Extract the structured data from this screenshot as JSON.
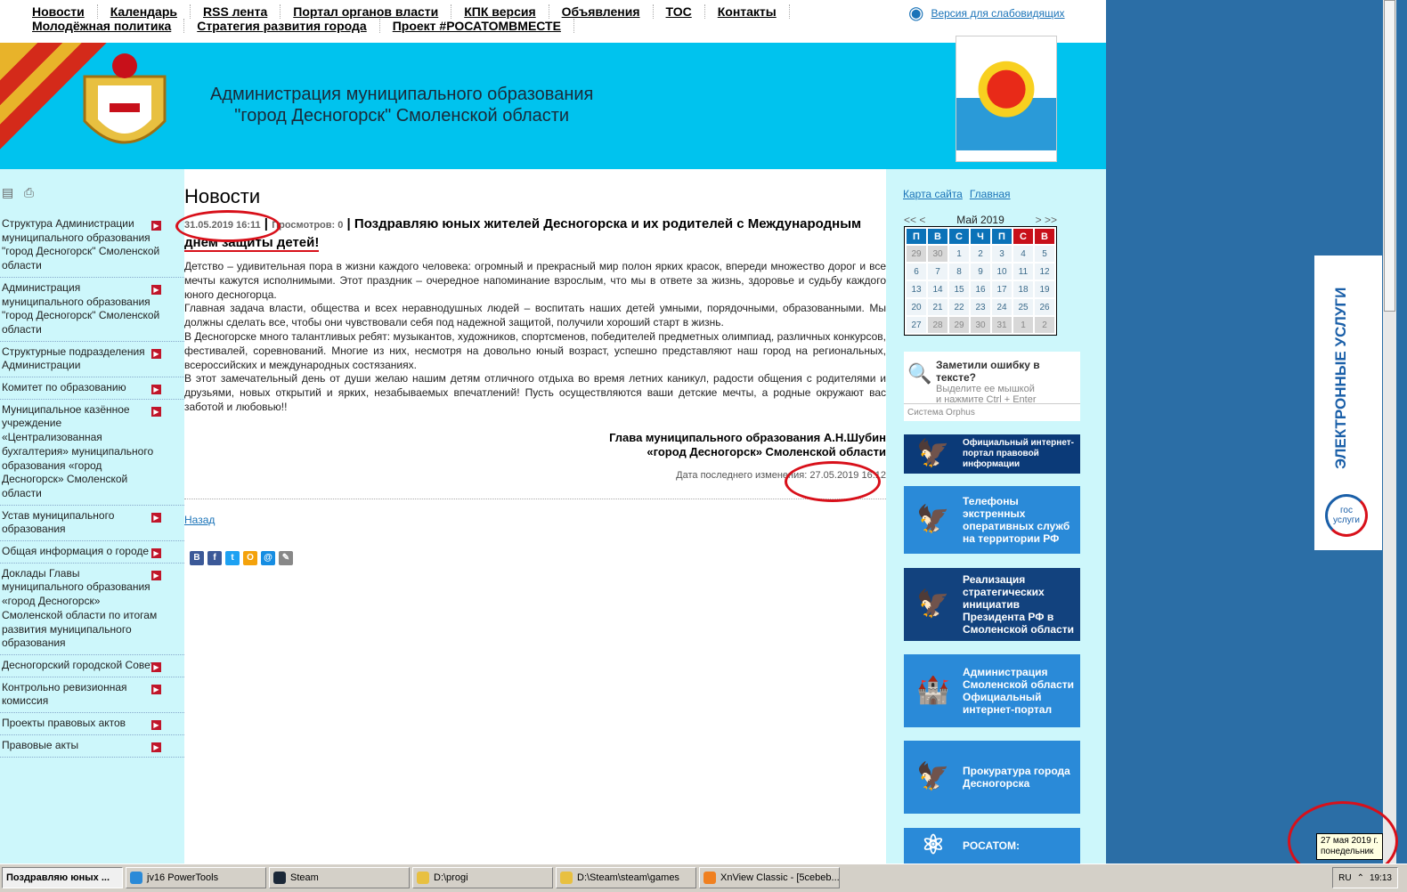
{
  "topnav": {
    "items": [
      "Новости",
      "Календарь",
      "RSS лента",
      "Портал органов власти",
      "КПК версия",
      "Объявления",
      "ТОС",
      "Контакты",
      "Молодёжная политика",
      "Стратегия развития города",
      "Проект #РОСАТОМВМЕСТЕ"
    ],
    "low_vision": "Версия для слабовидящих"
  },
  "header": {
    "title_line1": "Администрация муниципального образования",
    "title_line2": "\"город Десногорск\" Смоленской области"
  },
  "left_menu": [
    "Структура Администрации муниципального образования \"город Десногорск\" Смоленской области",
    "Администрация муниципального образования \"город Десногорск\" Смоленской области",
    "Структурные подразделения Администрации",
    "Комитет по образованию",
    "Муниципальное казённое учреждение «Централизованная бухгалтерия» муниципального образования «город Десногорск» Смоленской области",
    "Устав муниципального образования",
    "Общая информация о городе",
    "Доклады Главы муниципального образования «город Десногорск» Смоленской области по итогам развития муниципального образования",
    "Десногорский городской Совет",
    "Контрольно ревизионная комиссия",
    "Проекты правовых актов",
    "Правовые акты"
  ],
  "main": {
    "heading": "Новости",
    "date": "31.05.2019 16:11",
    "views": "Просмотров: 0",
    "title_a": "Поздравляю юных жителей Десногорска и их родителей с Международным ",
    "title_b": "днем защиты детей!",
    "paragraphs": [
      "Детство – удивительная пора в жизни каждого человека: огромный и прекрасный мир полон ярких красок, впереди множество дорог и все мечты кажутся исполнимыми. Этот праздник – очередное напоминание взрослым, что мы в ответе за жизнь, здоровье и судьбу каждого юного  десногорца.",
      "Главная задача власти, общества и всех неравнодушных людей – воспитать наших детей умными, порядочными, образованными. Мы должны сделать все, чтобы они чувствовали себя под надежной защитой, получили хороший старт в жизнь.",
      "В Десногорске много талантливых ребят: музыкантов, художников, спортсменов, победителей предметных олимпиад, различных конкурсов, фестивалей, соревнований. Многие из них, несмотря на довольно юный возраст, успешно представляют наш город на региональных, всероссийских и международных состязаниях.",
      "В этот замечательный день от души желаю нашим детям отличного отдыха во время летних каникул, радости общения с родителями и друзьями, новых открытий и ярких, незабываемых впечатлений! Пусть осуществляются ваши детские мечты, а родные окружают вас заботой и любовью!!"
    ],
    "sign1": "Глава муниципального образования А.Н.Шубин",
    "sign2": "«город Десногорск» Смоленской области",
    "modified_label": "Дата последнего изменения:",
    "modified": "27.05.2019 16:12",
    "back": "Назад",
    "share": [
      "В",
      "f",
      "t",
      "O",
      "@",
      "✎"
    ]
  },
  "right": {
    "sitemap": "Карта сайта",
    "home": "Главная",
    "cal": {
      "prev": "<< <",
      "next": "> >>",
      "month": "Май 2019",
      "days": [
        "П",
        "В",
        "С",
        "Ч",
        "П",
        "С",
        "В"
      ],
      "weeks": [
        [
          29,
          30,
          1,
          2,
          3,
          4,
          5
        ],
        [
          6,
          7,
          8,
          9,
          10,
          11,
          12
        ],
        [
          13,
          14,
          15,
          16,
          17,
          18,
          19
        ],
        [
          20,
          21,
          22,
          23,
          24,
          25,
          26
        ],
        [
          27,
          28,
          29,
          30,
          31,
          1,
          2
        ]
      ]
    },
    "orphus": {
      "title": "Заметили ошибку в тексте?",
      "l1": "Выделите ее мышкой",
      "l2": "и нажмите Ctrl + Enter",
      "sys": "Система Orphus"
    },
    "banners": [
      "Официальный интернет-портал правовой информации",
      "Телефоны экстренных оперативных служб на территории РФ",
      "Реализация стратегических инициатив Президента РФ в Смоленской области",
      "Администрация Смоленской области Официальный интернет-портал",
      "Прокуратура города Десногорска",
      "РОСАТОМ:"
    ]
  },
  "gosuslugi": {
    "vertical": "ЭЛЕКТРОННЫЕ УСЛУГИ",
    "logo": "гос услуги"
  },
  "tooltip": {
    "l1": "27 мая 2019 г.",
    "l2": "понедельник"
  },
  "taskbar": {
    "items": [
      "Поздравляю юных ...",
      "jv16 PowerTools",
      "Steam",
      "D:\\progi",
      "D:\\Steam\\steam\\games",
      "XnView Classic - [5cebeb..."
    ],
    "lang": "RU",
    "clock": "19:13"
  }
}
